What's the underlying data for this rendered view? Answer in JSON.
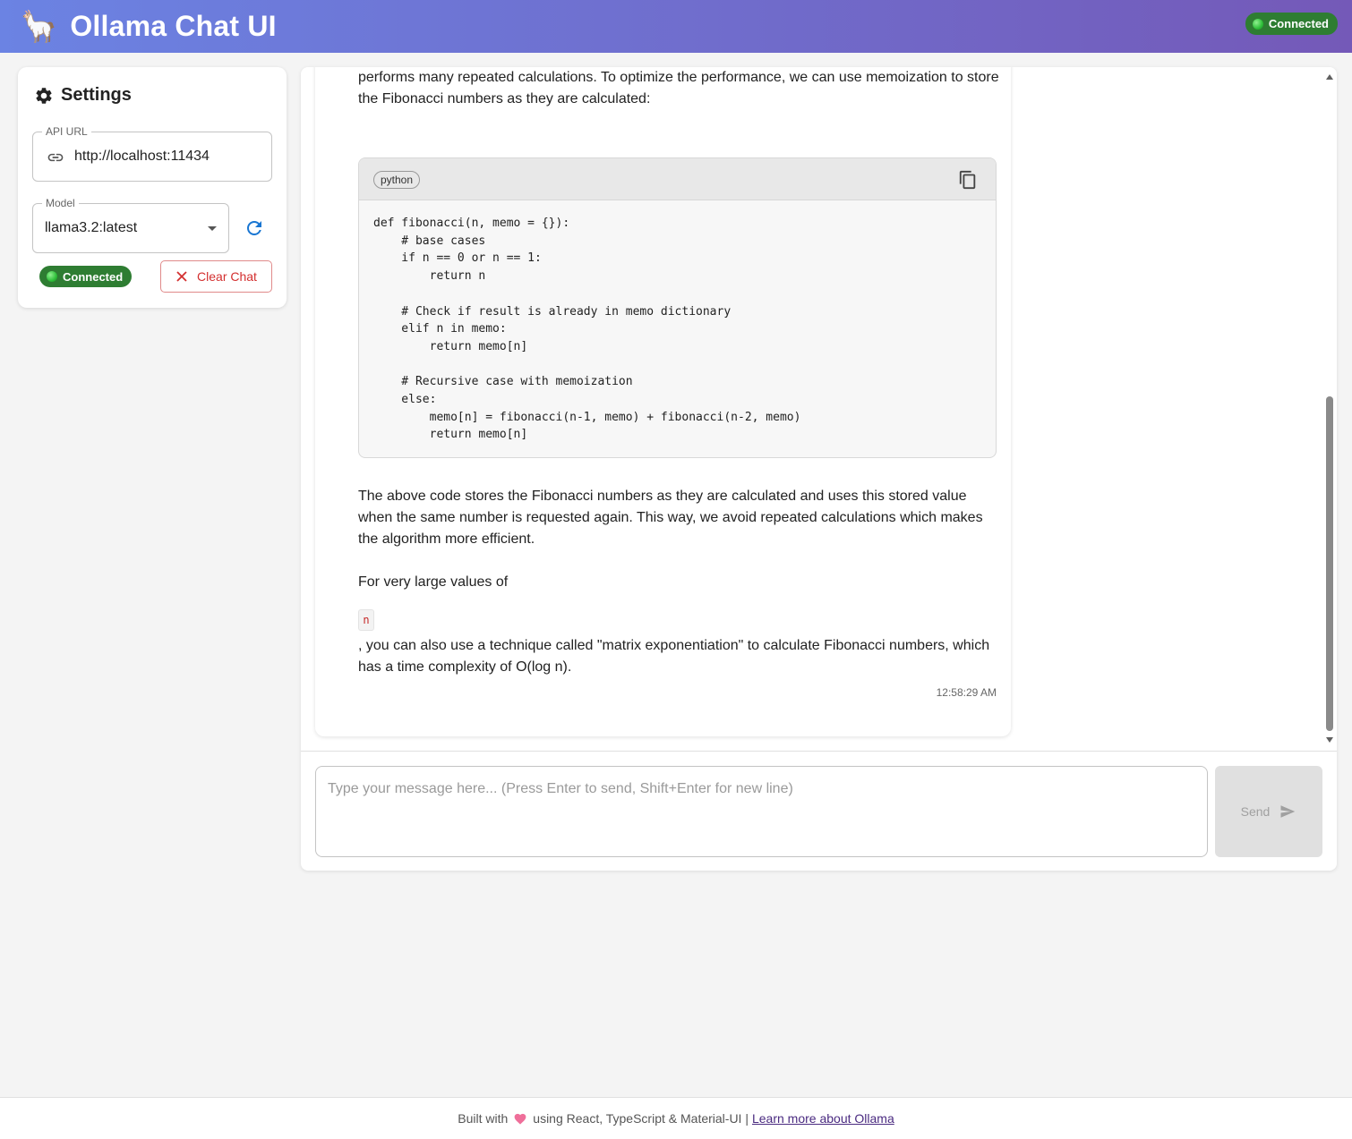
{
  "app": {
    "logo_icon": "llama-icon",
    "title": "Ollama Chat UI",
    "status": "Connected"
  },
  "settings": {
    "title": "Settings",
    "api_url_label": "API URL",
    "api_url_value": "http://localhost:11434",
    "model_label": "Model",
    "model_value": "llama3.2:latest",
    "status": "Connected",
    "clear_label": "Clear Chat"
  },
  "message": {
    "intro": "However, please note that this implementation has an exponential time complexity because it performs many repeated calculations. To optimize the performance, we can use memoization to store the Fibonacci numbers as they are calculated:",
    "code_language": "python",
    "code": "def fibonacci(n, memo = {}):\n    # base cases\n    if n == 0 or n == 1:\n        return n\n\n    # Check if result is already in memo dictionary\n    elif n in memo:\n        return memo[n]\n\n    # Recursive case with memoization\n    else:\n        memo[n] = fibonacci(n-1, memo) + fibonacci(n-2, memo)\n        return memo[n]",
    "explanation": "The above code stores the Fibonacci numbers as they are calculated and uses this stored value when the same number is requested again. This way, we avoid repeated calculations which makes the algorithm more efficient.",
    "large_values_prefix": "For very large values of",
    "inline_code": "n",
    "large_values_suffix": ", you can also use a technique called \"matrix exponentiation\" to calculate Fibonacci numbers, which has a time complexity of O(log n).",
    "timestamp": "12:58:29 AM"
  },
  "composer": {
    "placeholder": "Type your message here... (Press Enter to send, Shift+Enter for new line)",
    "send_label": "Send"
  },
  "footer": {
    "built_with": "Built with",
    "using": "using React, TypeScript & Material-UI |",
    "link_text": "Learn more about Ollama"
  },
  "colors": {
    "header_gradient_start": "#6b83e3",
    "header_gradient_end": "#7459b8",
    "connected_green": "#2e7d32",
    "clear_red": "#d32f2f",
    "accent_blue": "#1976d2"
  }
}
